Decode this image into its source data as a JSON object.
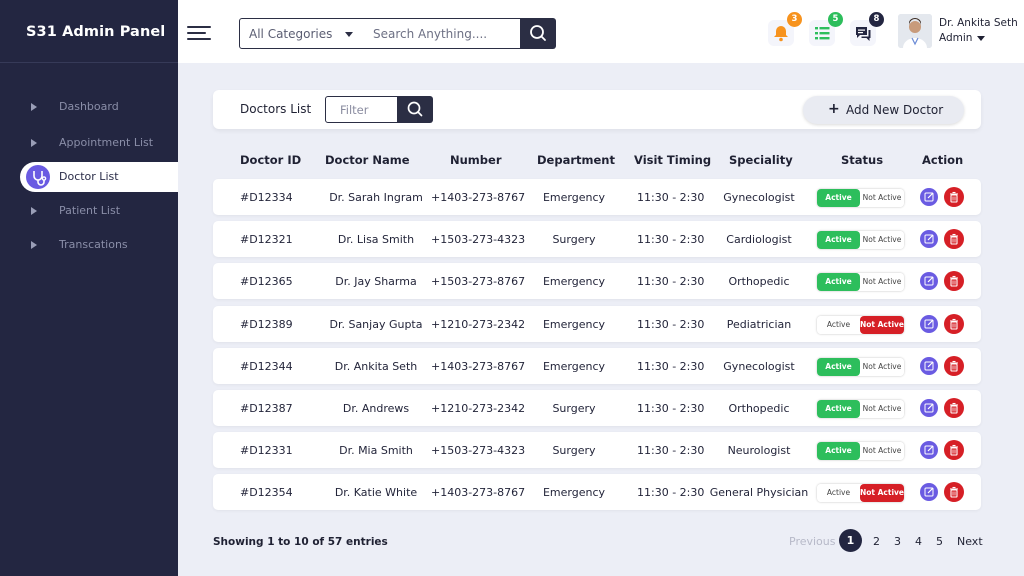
{
  "app": {
    "title": "S31 Admin Panel"
  },
  "sidebar": {
    "items": [
      {
        "label": "Dashboard",
        "active": false
      },
      {
        "label": "Appointment List",
        "active": false
      },
      {
        "label": "Doctor List",
        "active": true
      },
      {
        "label": "Patient List",
        "active": false
      },
      {
        "label": "Transcations",
        "active": false
      }
    ]
  },
  "header": {
    "category": "All Categories",
    "search_placeholder": "Search Anything....",
    "notifications": [
      {
        "icon": "bell-icon",
        "count": "3",
        "color": "#f7931e"
      },
      {
        "icon": "list-icon",
        "count": "5",
        "color": "#2dbe5c"
      },
      {
        "icon": "chat-icon",
        "count": "8",
        "color": "#232641"
      }
    ],
    "user": {
      "name": "Dr. Ankita Seth",
      "role": "Admin"
    }
  },
  "toolbar": {
    "title": "Doctors List",
    "filter_placeholder": "Filter",
    "add_label": "Add New Doctor"
  },
  "table": {
    "headers": {
      "id": "Doctor ID",
      "name": "Doctor Name",
      "number": "Number",
      "department": "Department",
      "timing": "Visit Timing",
      "speciality": "Speciality",
      "status": "Status",
      "action": "Action"
    },
    "status_labels": {
      "active": "Active",
      "inactive": "Not Active"
    },
    "rows": [
      {
        "id": "#D12334",
        "name": "Dr. Sarah Ingram",
        "number": "+1403-273-8767",
        "department": "Emergency",
        "timing": "11:30 - 2:30",
        "speciality": "Gynecologist",
        "active": true
      },
      {
        "id": "#D12321",
        "name": "Dr. Lisa Smith",
        "number": "+1503-273-4323",
        "department": "Surgery",
        "timing": "11:30 - 2:30",
        "speciality": "Cardiologist",
        "active": true
      },
      {
        "id": "#D12365",
        "name": "Dr. Jay Sharma",
        "number": "+1503-273-8767",
        "department": "Emergency",
        "timing": "11:30 - 2:30",
        "speciality": "Orthopedic",
        "active": true
      },
      {
        "id": "#D12389",
        "name": "Dr. Sanjay Gupta",
        "number": "+1210-273-2342",
        "department": "Emergency",
        "timing": "11:30 - 2:30",
        "speciality": "Pediatrician",
        "active": false
      },
      {
        "id": "#D12344",
        "name": "Dr. Ankita Seth",
        "number": "+1403-273-8767",
        "department": "Emergency",
        "timing": "11:30 - 2:30",
        "speciality": "Gynecologist",
        "active": true
      },
      {
        "id": "#D12387",
        "name": "Dr. Andrews",
        "number": "+1210-273-2342",
        "department": "Surgery",
        "timing": "11:30 - 2:30",
        "speciality": "Orthopedic",
        "active": true
      },
      {
        "id": "#D12331",
        "name": "Dr. Mia Smith",
        "number": "+1503-273-4323",
        "department": "Surgery",
        "timing": "11:30 - 2:30",
        "speciality": "Neurologist",
        "active": true
      },
      {
        "id": "#D12354",
        "name": "Dr. Katie White",
        "number": "+1403-273-8767",
        "department": "Emergency",
        "timing": "11:30 - 2:30",
        "speciality": "General Physician",
        "active": false
      }
    ]
  },
  "pagination": {
    "summary": "Showing 1 to 10 of 57 entries",
    "previous": "Previous",
    "next": "Next",
    "current": "1",
    "pages": [
      "1",
      "2",
      "3",
      "4",
      "5"
    ]
  }
}
